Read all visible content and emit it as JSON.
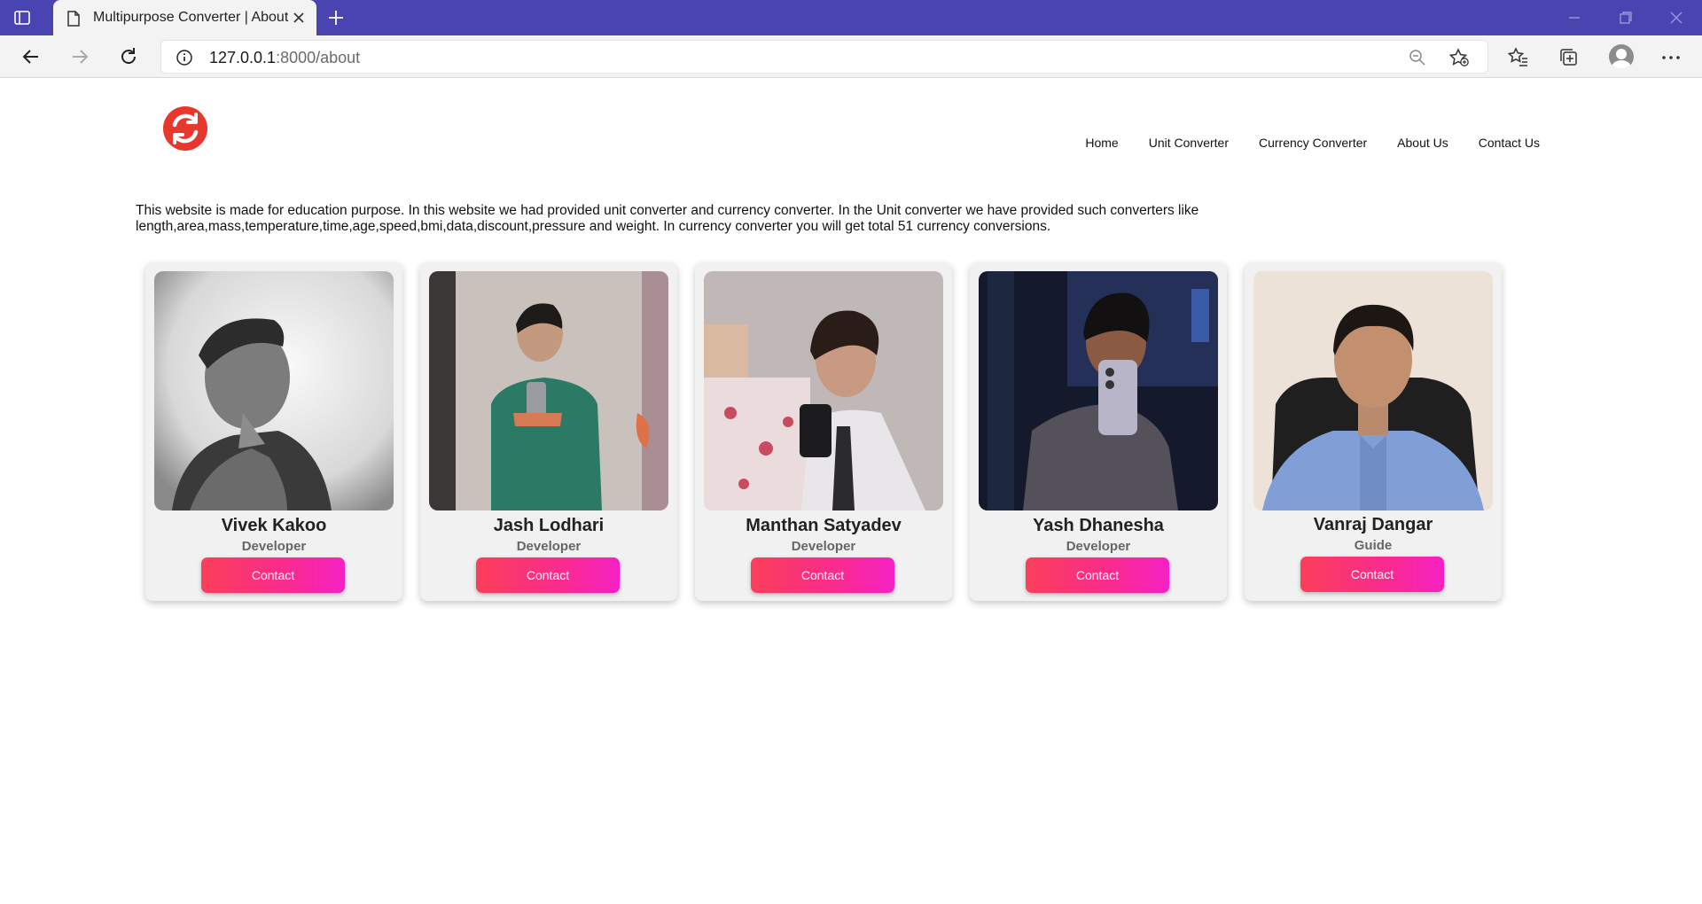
{
  "browser": {
    "tab_title": "Multipurpose Converter | About",
    "url_host": "127.0.0.1",
    "url_rest": ":8000/about"
  },
  "site": {
    "nav": [
      {
        "label": "Home"
      },
      {
        "label": "Unit Converter"
      },
      {
        "label": "Currency Converter"
      },
      {
        "label": "About Us"
      },
      {
        "label": "Contact Us"
      }
    ],
    "about_text": "This website is made for education purpose. In this website we had provided unit converter and currency converter. In the Unit converter we have provided such converters like length,area,mass,temperature,time,age,speed,bmi,data,discount,pressure and weight. In currency converter you will get total 51 currency conversions.",
    "team": [
      {
        "name": "Vivek Kakoo",
        "role": "Developer",
        "button": "Contact"
      },
      {
        "name": "Jash Lodhari",
        "role": "Developer",
        "button": "Contact"
      },
      {
        "name": "Manthan Satyadev",
        "role": "Developer",
        "button": "Contact"
      },
      {
        "name": "Yash Dhanesha",
        "role": "Developer",
        "button": "Contact"
      },
      {
        "name": "Vanraj Dangar",
        "role": "Guide",
        "button": "Contact"
      }
    ]
  },
  "colors": {
    "titlebar": "#4a44b2",
    "logo": "#e8372c",
    "button_gradient_start": "#fb3f5a",
    "button_gradient_end": "#f521c4"
  }
}
